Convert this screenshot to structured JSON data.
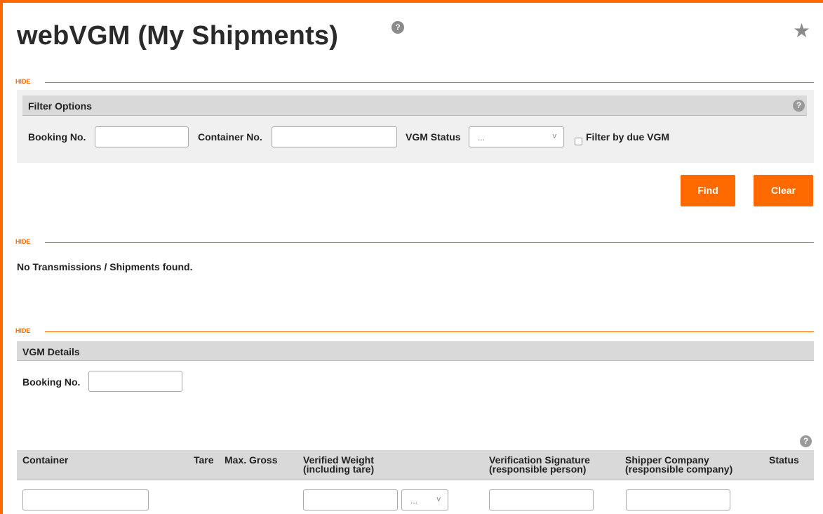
{
  "page": {
    "title": "webVGM (My Shipments)",
    "title_help": "?",
    "favorite_icon": "star-icon"
  },
  "sections": {
    "hide_label": "HIDE"
  },
  "filter": {
    "header": "Filter Options",
    "help": "?",
    "booking_label": "Booking No.",
    "booking_value": "",
    "container_label": "Container No.",
    "container_value": "",
    "status_label": "VGM Status",
    "status_selected": "...",
    "due_checkbox_label": "Filter by due VGM",
    "due_checked": false
  },
  "actions": {
    "find": "Find",
    "clear": "Clear"
  },
  "results": {
    "empty_message": "No Transmissions / Shipments found."
  },
  "details": {
    "header": "VGM Details",
    "booking_label": "Booking No.",
    "booking_value": "",
    "help": "?",
    "columns": {
      "container": "Container",
      "tare": "Tare",
      "max_gross": "Max. Gross",
      "verified_weight": "Verified Weight",
      "verified_weight_sub": "(including tare)",
      "signature": "Verification Signature",
      "signature_sub": "(responsible person)",
      "shipper": "Shipper Company",
      "shipper_sub": "(responsible company)",
      "status": "Status"
    },
    "row": {
      "container_value": "",
      "weight_value": "",
      "unit_selected": "...",
      "signature_value": "",
      "shipper_value": ""
    }
  },
  "colors": {
    "accent": "#ff6a00",
    "section_bg": "#d9d9d9",
    "panel_bg": "#f0f0f0"
  }
}
